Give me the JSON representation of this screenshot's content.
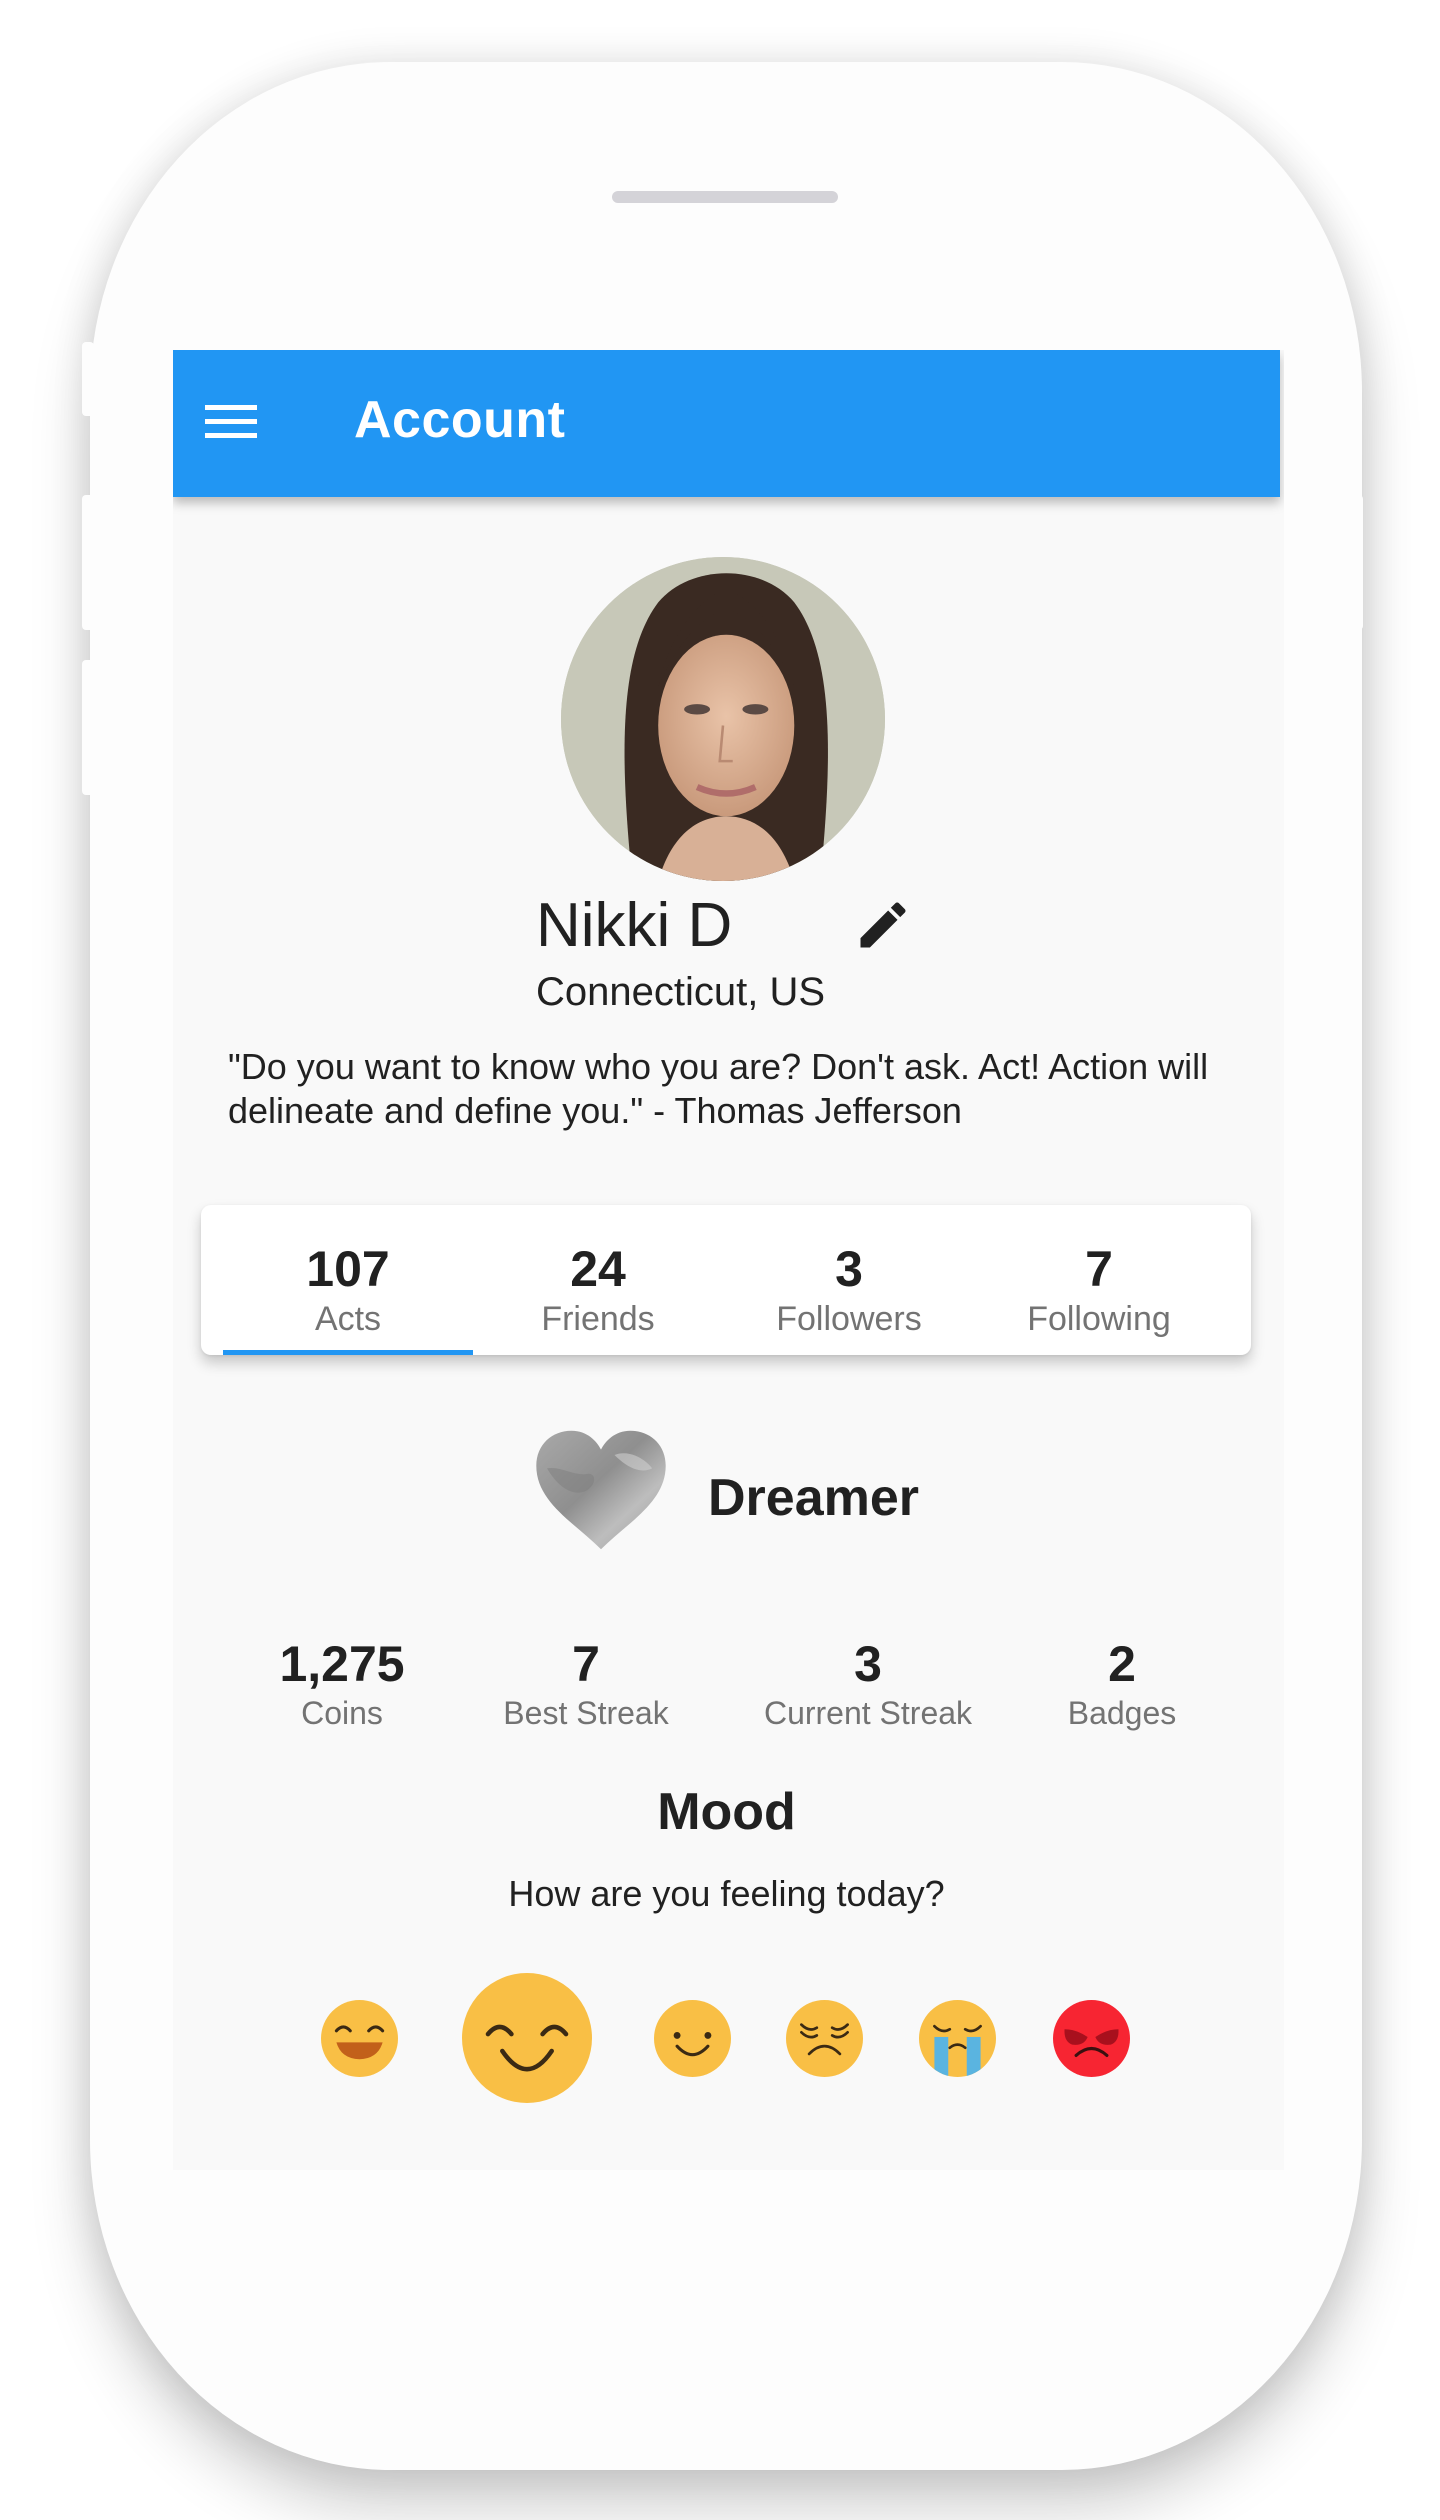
{
  "app_bar": {
    "title": "Account",
    "menu_icon": "hamburger-menu-icon",
    "color": "#2196F3"
  },
  "profile": {
    "name": "Nikki D",
    "location": "Connecticut, US",
    "quote": "\"Do you want to know who you are? Don't ask. Act! Action will delineate and define you.\" - Thomas Jefferson",
    "edit_icon": "pencil-icon",
    "avatar": "profile-photo"
  },
  "stats_tabs": [
    {
      "value": "107",
      "label": "Acts",
      "selected": true
    },
    {
      "value": "24",
      "label": "Friends",
      "selected": false
    },
    {
      "value": "3",
      "label": "Followers",
      "selected": false
    },
    {
      "value": "7",
      "label": "Following",
      "selected": false
    }
  ],
  "rank": {
    "icon": "heart-icon",
    "title": "Dreamer"
  },
  "stats": [
    {
      "value": "1,275",
      "label": "Coins"
    },
    {
      "value": "7",
      "label": "Best Streak"
    },
    {
      "value": "3",
      "label": "Current Streak"
    },
    {
      "value": "2",
      "label": "Badges"
    }
  ],
  "mood": {
    "title": "Mood",
    "prompt": "How are you feeling today?",
    "options": [
      {
        "name": "grinning",
        "selected": false
      },
      {
        "name": "smiling",
        "selected": true
      },
      {
        "name": "slight-smile",
        "selected": false
      },
      {
        "name": "persevering",
        "selected": false
      },
      {
        "name": "crying",
        "selected": false
      },
      {
        "name": "angry",
        "selected": false
      }
    ],
    "colors": {
      "yellow": "#F9BF45",
      "red": "#F72532",
      "tear": "#5AB4E0"
    }
  }
}
